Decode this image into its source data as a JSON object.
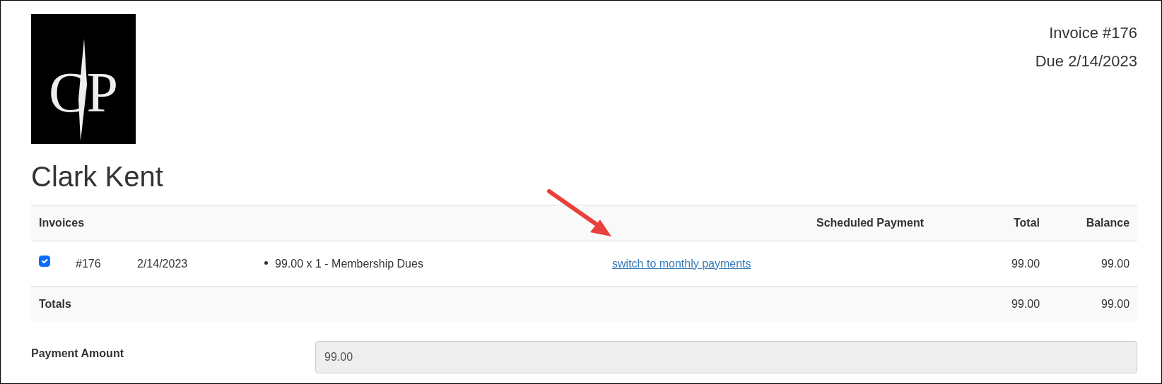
{
  "logo": {
    "text": "CP"
  },
  "invoice": {
    "number": "Invoice #176",
    "due": "Due 2/14/2023"
  },
  "customer": "Clark Kent",
  "table": {
    "columns": [
      "Invoices",
      "Scheduled Payment",
      "Total",
      "Balance"
    ],
    "rows": [
      {
        "checked": true,
        "number": "#176",
        "date": "2/14/2023",
        "items": [
          "99.00 x 1 - Membership Dues"
        ],
        "scheduled_link": "switch to monthly payments",
        "total": "99.00",
        "balance": "99.00"
      }
    ],
    "totals": {
      "label": "Totals",
      "total": "99.00",
      "balance": "99.00"
    }
  },
  "payment": {
    "label": "Payment Amount",
    "value": "99.00",
    "disabled": true
  }
}
